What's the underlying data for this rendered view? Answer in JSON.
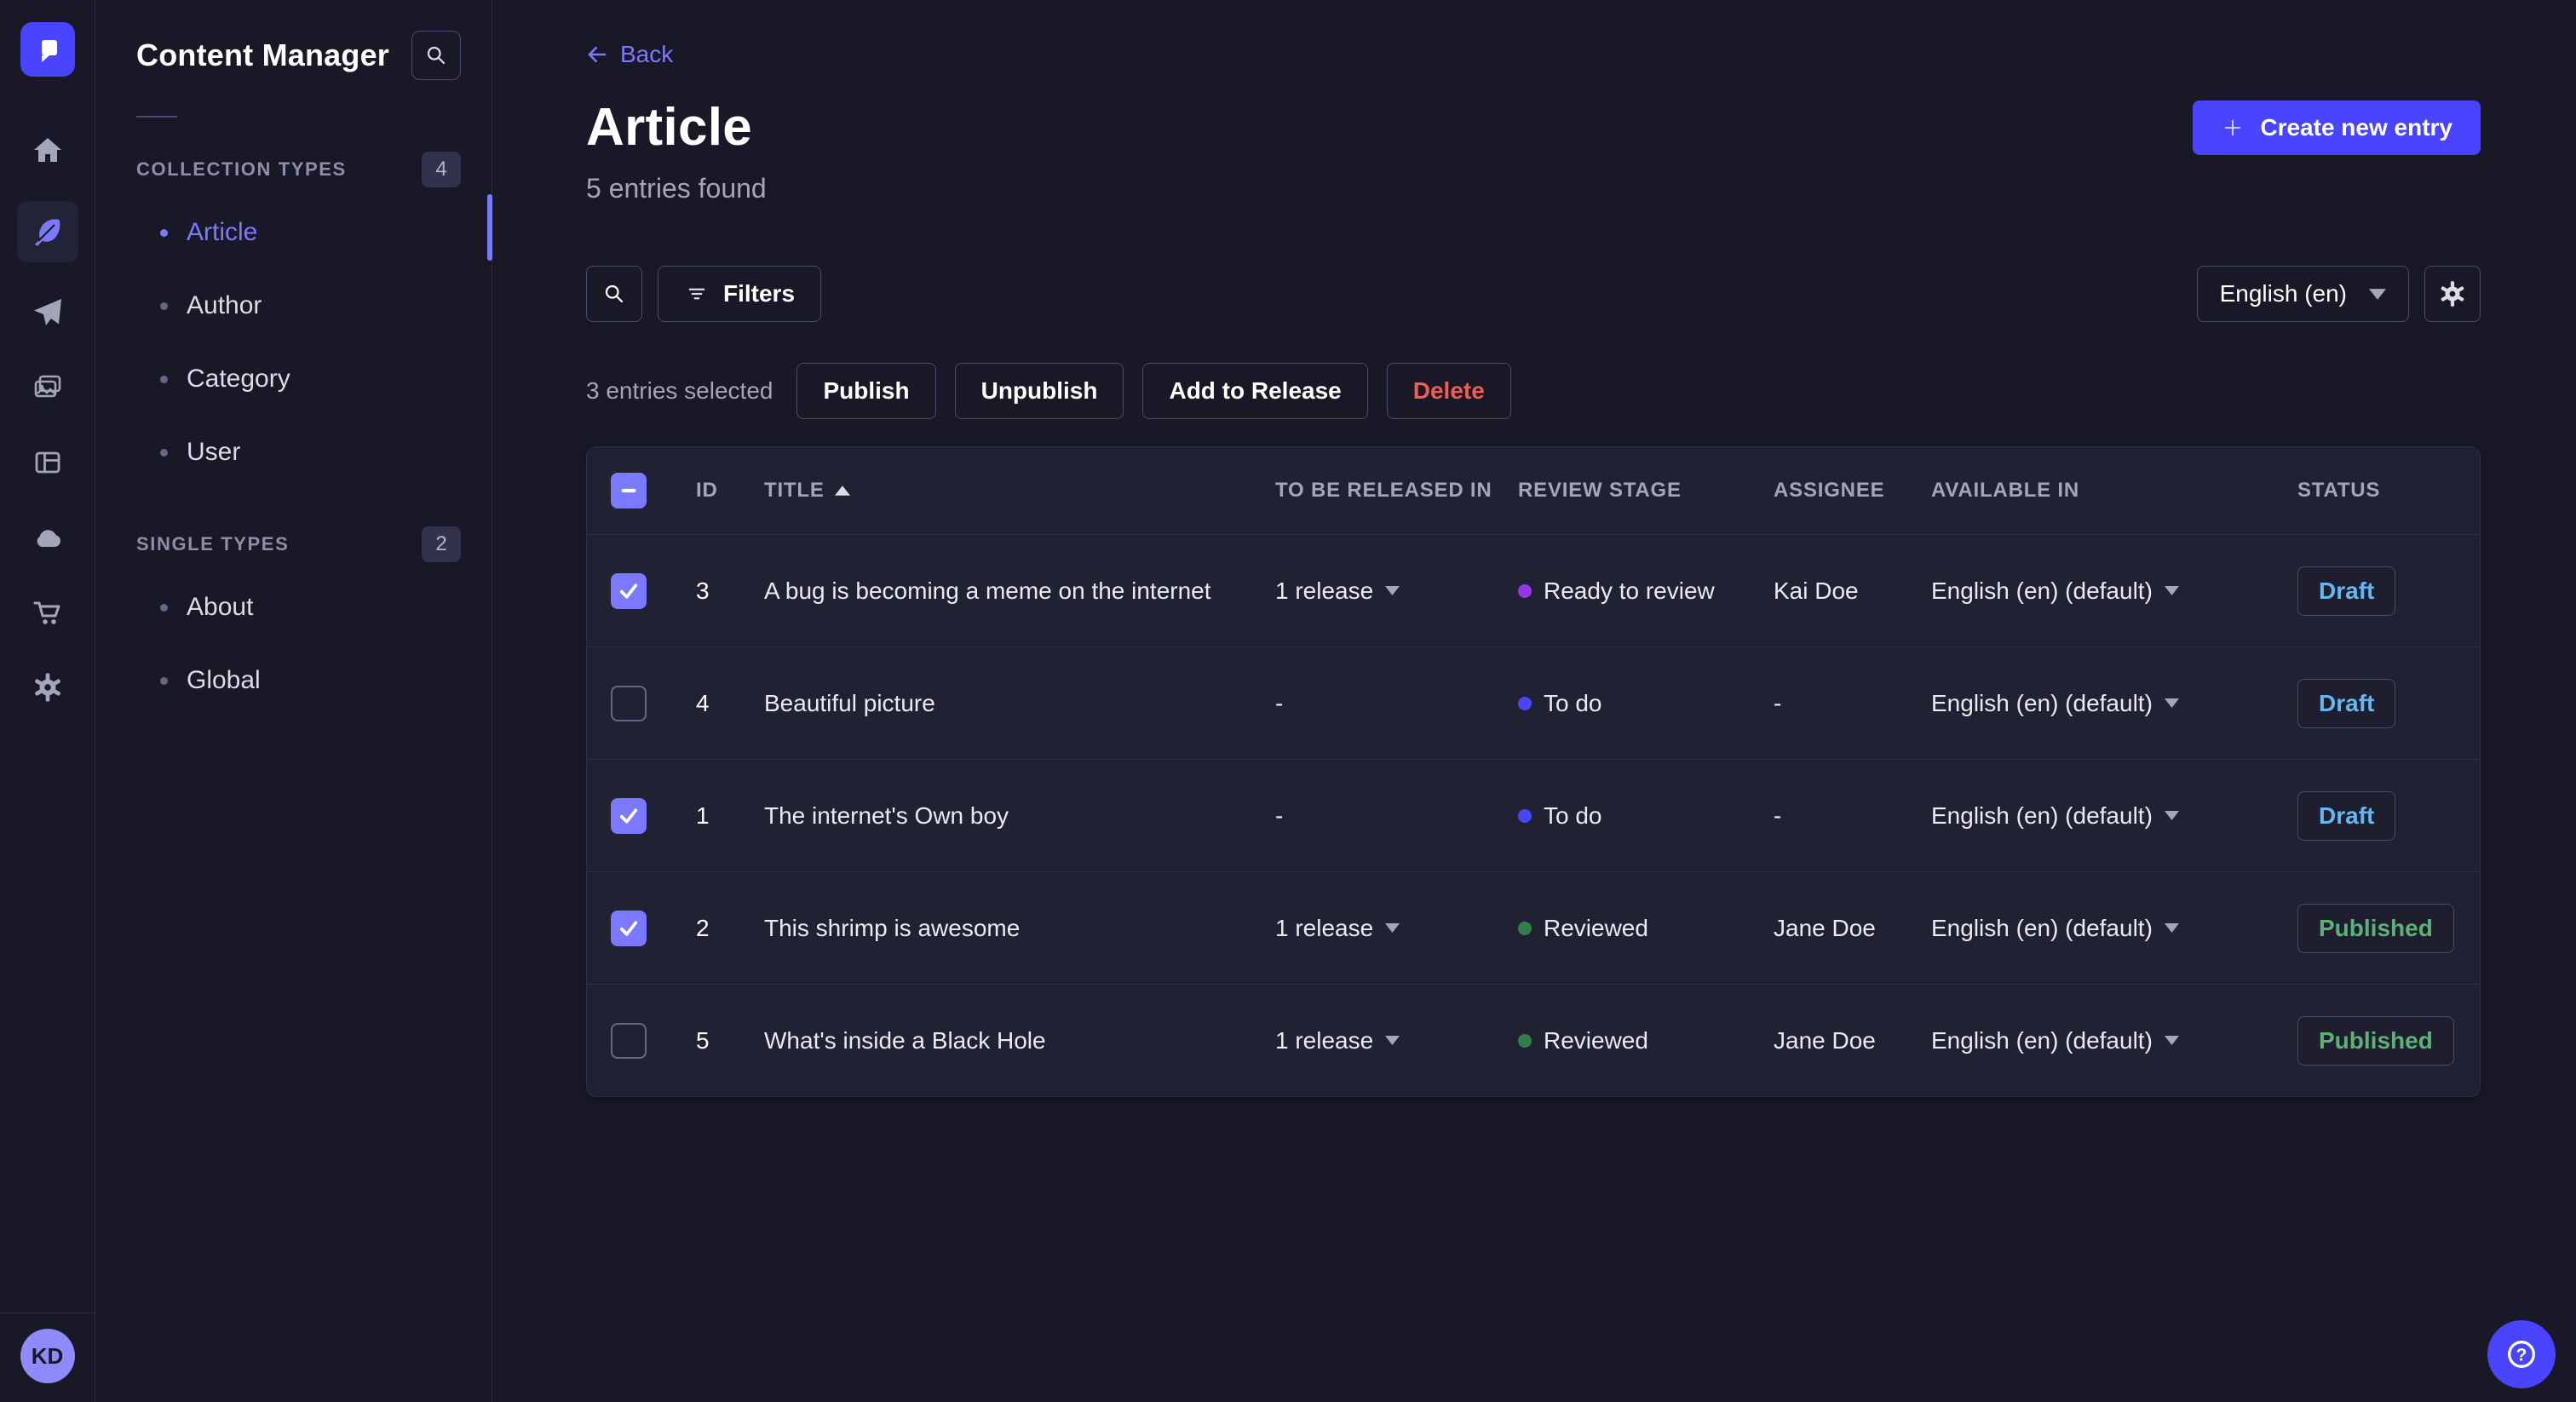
{
  "colors": {
    "page_bg": "#181826",
    "card_bg": "#212134",
    "primary": "#4945ff",
    "primary_light": "#7b79ff",
    "text_secondary": "#a5a5ba",
    "danger": "#ee5e52",
    "status_draft_text": "#66b7f1",
    "status_published_text": "#5cb176",
    "stage_todo_dot": "#4945ff",
    "stage_ready_dot": "#9736e8",
    "stage_reviewed_dot": "#328048"
  },
  "rail": {
    "icons": [
      "home",
      "content-manager",
      "releases",
      "media-library",
      "content-type-builder",
      "deploy",
      "marketplace",
      "settings"
    ],
    "active_icon": "content-manager",
    "avatar_initials": "KD"
  },
  "sidebar": {
    "title": "Content Manager",
    "sections": [
      {
        "label": "COLLECTION TYPES",
        "count": "4",
        "items": [
          {
            "label": "Article"
          },
          {
            "label": "Author"
          },
          {
            "label": "Category"
          },
          {
            "label": "User"
          }
        ]
      },
      {
        "label": "SINGLE TYPES",
        "count": "2",
        "items": [
          {
            "label": "About"
          },
          {
            "label": "Global"
          }
        ]
      }
    ]
  },
  "header": {
    "back": "Back",
    "title": "Article",
    "subtitle": "5 entries found",
    "create_button": "Create new entry"
  },
  "toolbar": {
    "filters_label": "Filters",
    "locale": "English (en)"
  },
  "selection": {
    "text": "3 entries selected",
    "publish": "Publish",
    "unpublish": "Unpublish",
    "add_to_release": "Add to Release",
    "delete": "Delete"
  },
  "table": {
    "columns": {
      "id": "ID",
      "title": "TITLE",
      "release": "TO BE RELEASED IN",
      "stage": "REVIEW STAGE",
      "assignee": "ASSIGNEE",
      "available": "AVAILABLE IN",
      "status": "STATUS"
    },
    "sort": {
      "column": "TITLE",
      "direction": "ascending"
    },
    "rows": [
      {
        "id": "3",
        "title": "A bug is becoming a meme on the internet",
        "release": "1 release",
        "stage": "Ready to review",
        "stage_color": "#9736e8",
        "assignee": "Kai Doe",
        "available": "English (en) (default)",
        "status": "Draft",
        "checked": true
      },
      {
        "id": "4",
        "title": "Beautiful picture",
        "release": "-",
        "stage": "To do",
        "stage_color": "#4945ff",
        "assignee": "-",
        "available": "English (en) (default)",
        "status": "Draft",
        "checked": false
      },
      {
        "id": "1",
        "title": "The internet's Own boy",
        "release": "-",
        "stage": "To do",
        "stage_color": "#4945ff",
        "assignee": "-",
        "available": "English (en) (default)",
        "status": "Draft",
        "checked": true
      },
      {
        "id": "2",
        "title": "This shrimp is awesome",
        "release": "1 release",
        "stage": "Reviewed",
        "stage_color": "#328048",
        "assignee": "Jane Doe",
        "available": "English (en) (default)",
        "status": "Published",
        "checked": true
      },
      {
        "id": "5",
        "title": "What's inside a Black Hole",
        "release": "1 release",
        "stage": "Reviewed",
        "stage_color": "#328048",
        "assignee": "Jane Doe",
        "available": "English (en) (default)",
        "status": "Published",
        "checked": false
      }
    ]
  }
}
